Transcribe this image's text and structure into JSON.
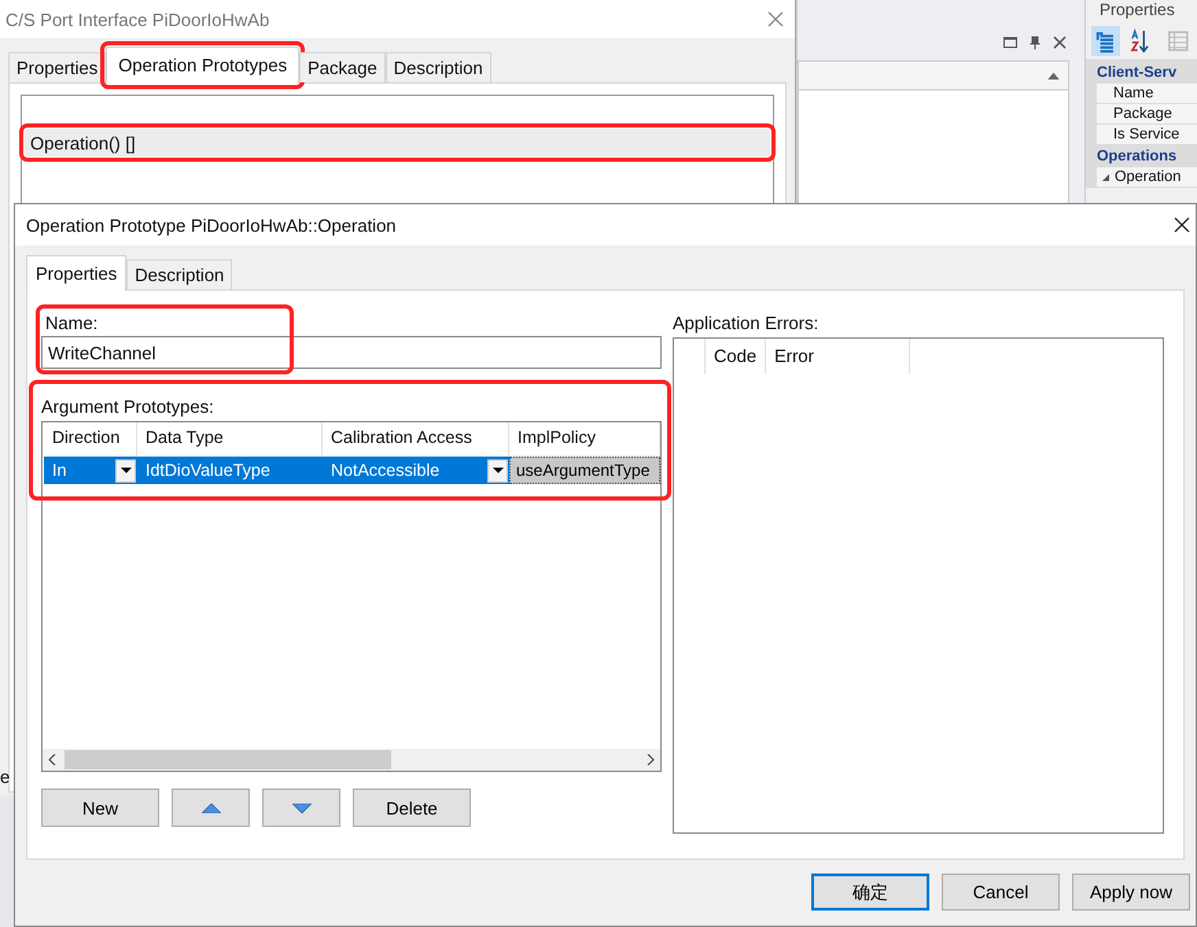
{
  "background_dialog": {
    "title": "C/S Port Interface PiDoorIoHwAb",
    "tabs": [
      {
        "label": "Properties",
        "selected": false,
        "highlighted": false
      },
      {
        "label": "Operation Prototypes",
        "selected": true,
        "highlighted": true
      },
      {
        "label": "Package",
        "selected": false,
        "highlighted": false
      },
      {
        "label": "Description",
        "selected": false,
        "highlighted": false
      }
    ],
    "list_rows": [
      {
        "label": "Operation() []",
        "selected": true,
        "highlighted": true
      }
    ]
  },
  "properties_panel": {
    "title": "Properties",
    "groups": [
      {
        "label": "Client-Serv",
        "rows": [
          {
            "label": "Name",
            "expandable": false
          },
          {
            "label": "Package",
            "expandable": false
          },
          {
            "label": "Is Service",
            "expandable": false
          }
        ]
      },
      {
        "label": "Operations",
        "rows": [
          {
            "label": "Operation",
            "expandable": true
          }
        ]
      }
    ]
  },
  "side_fragment": "e",
  "dialog": {
    "title": "Operation Prototype PiDoorIoHwAb::Operation",
    "tabs": [
      {
        "label": "Properties",
        "selected": true
      },
      {
        "label": "Description",
        "selected": false
      }
    ],
    "name_label": "Name:",
    "name_value": "WriteChannel",
    "name_highlighted": true,
    "arguments_label": "Argument Prototypes:",
    "arguments_highlighted": true,
    "columns": [
      "Direction",
      "Data Type",
      "Calibration Access",
      "ImplPolicy"
    ],
    "rows": [
      {
        "direction": "In",
        "data_type": "IdtDioValueType",
        "calibration_access": "NotAccessible",
        "impl_policy": "useArgumentType",
        "selected": true
      }
    ],
    "buttons": [
      {
        "kind": "text",
        "label": "New"
      },
      {
        "kind": "up"
      },
      {
        "kind": "down"
      },
      {
        "kind": "text",
        "label": "Delete"
      }
    ],
    "errors_label": "Application Errors:",
    "error_columns": [
      "Code",
      "Error"
    ],
    "footer_buttons": [
      {
        "label": "确定",
        "default": true
      },
      {
        "label": "Cancel",
        "default": false
      },
      {
        "label": "Apply now",
        "default": false
      }
    ]
  }
}
